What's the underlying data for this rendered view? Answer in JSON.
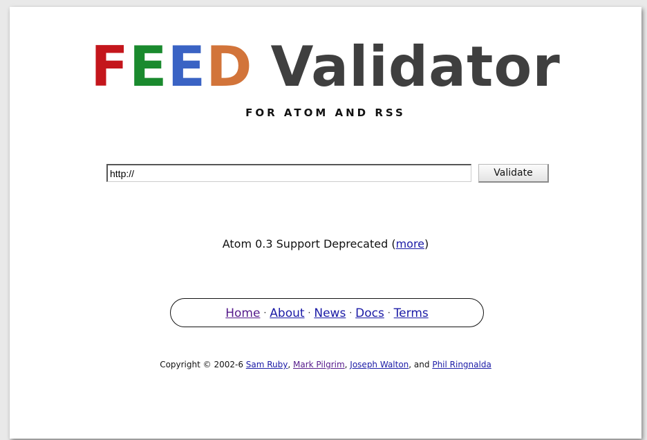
{
  "logo": {
    "letters": [
      {
        "char": "F",
        "color": "#c4161c"
      },
      {
        "char": "E",
        "color": "#1a8a2e"
      },
      {
        "char": "E",
        "color": "#3a63c4"
      },
      {
        "char": "D",
        "color": "#d2743a"
      }
    ],
    "rest": "Validator",
    "rest_color": "#3f3f3f"
  },
  "tagline": "FOR ATOM AND RSS",
  "form": {
    "url_value": "http://",
    "validate_label": "Validate"
  },
  "notice": {
    "text_before": "Atom 0.3 Support Deprecated (",
    "link": "more",
    "text_after": ")"
  },
  "nav": {
    "separator": "·",
    "items": [
      "Home",
      "About",
      "News",
      "Docs",
      "Terms"
    ]
  },
  "copyright": {
    "prefix": "Copyright © 2002-6 ",
    "authors": [
      "Sam Ruby",
      "Mark Pilgrim",
      "Joseph Walton",
      "Phil Ringnalda"
    ],
    "sep1": ", ",
    "sep2": ", ",
    "sep3": ", and "
  }
}
